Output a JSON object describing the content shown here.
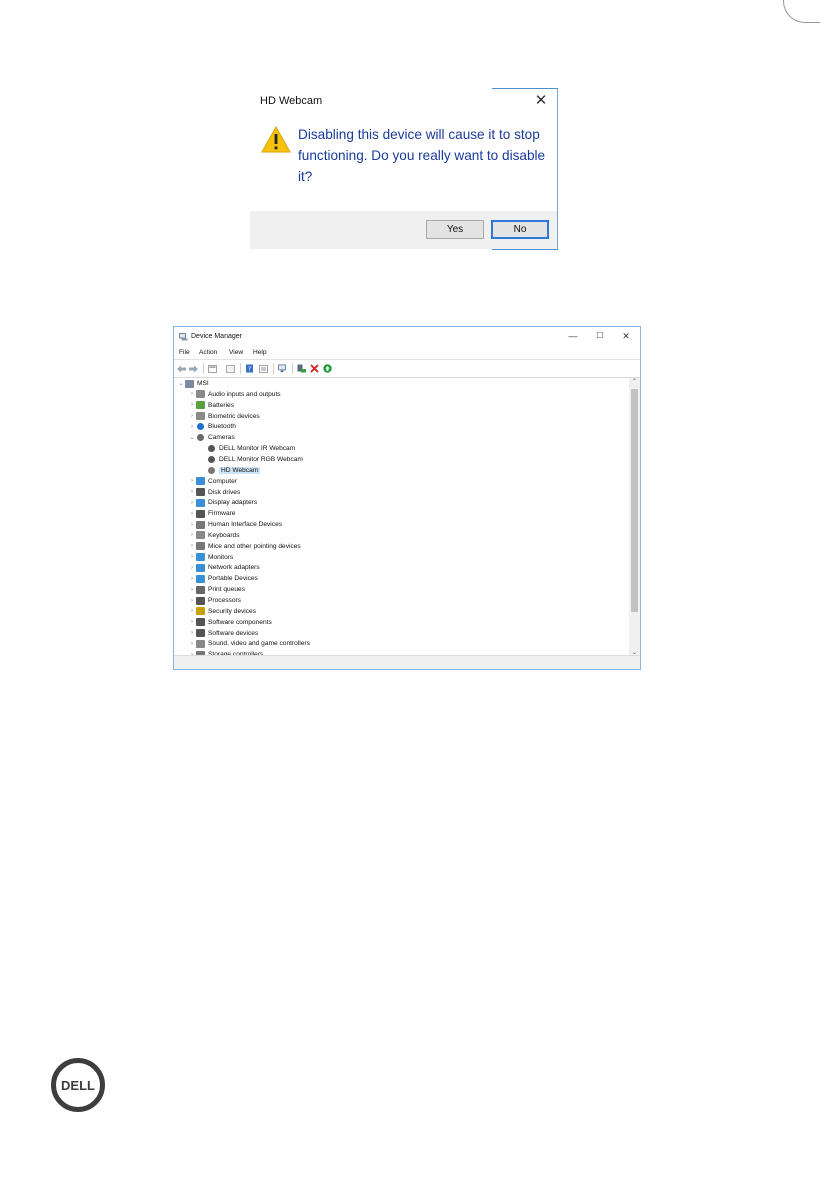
{
  "dialog": {
    "title": "HD Webcam",
    "close_glyph": "✕",
    "icon": "warning-icon",
    "message": "Disabling this device will cause it to stop functioning. Do you really want to disable it?",
    "buttons": {
      "yes": "Yes",
      "no": "No"
    },
    "colors": {
      "message": "#1a3a9a",
      "footer": "#f0f0f0",
      "focus": "#2d7ad6",
      "warning": "#f4c20d"
    }
  },
  "device_manager": {
    "title": "Device Manager",
    "window_buttons": {
      "minimize": "—",
      "maximize": "☐",
      "close": "✕"
    },
    "menu": [
      "File",
      "Action",
      "View",
      "Help"
    ],
    "toolbar_icons": [
      "back-icon",
      "forward-icon",
      "properties-icon",
      "show-hidden-icon",
      "help-icon",
      "driver-update-icon",
      "scan-icon",
      "enable-device-icon",
      "uninstall-device-icon",
      "update-icon"
    ],
    "tree": [
      {
        "label": "MSI",
        "level": 0,
        "expanded": true,
        "icon": "computer-icon",
        "color": "#7a8aa0"
      },
      {
        "label": "Audio inputs and outputs",
        "level": 1,
        "icon": "speaker-icon",
        "color": "#8a8a8a"
      },
      {
        "label": "Batteries",
        "level": 1,
        "icon": "battery-icon",
        "color": "#5aa040"
      },
      {
        "label": "Biometric devices",
        "level": 1,
        "icon": "biometric-icon",
        "color": "#8a8a8a"
      },
      {
        "label": "Bluetooth",
        "level": 1,
        "icon": "bluetooth-icon",
        "color": "#1f6fd0"
      },
      {
        "label": "Cameras",
        "level": 1,
        "expanded": true,
        "icon": "camera-icon",
        "color": "#6a6a6a"
      },
      {
        "label": "DELL Monitor IR Webcam",
        "level": 2,
        "icon": "webcam-icon",
        "color": "#555555"
      },
      {
        "label": "DELL Monitor RGB Webcam",
        "level": 2,
        "icon": "webcam-icon",
        "color": "#555555"
      },
      {
        "label": "HD Webcam",
        "level": 2,
        "selected": true,
        "icon": "webcam-disabled-icon",
        "color": "#777777"
      },
      {
        "label": "Computer",
        "level": 1,
        "icon": "monitor-icon",
        "color": "#3a8fd6"
      },
      {
        "label": "Disk drives",
        "level": 1,
        "icon": "disk-icon",
        "color": "#555555"
      },
      {
        "label": "Display adapters",
        "level": 1,
        "icon": "display-adapter-icon",
        "color": "#3a8fd6"
      },
      {
        "label": "Firmware",
        "level": 1,
        "icon": "firmware-icon",
        "color": "#555555"
      },
      {
        "label": "Human Interface Devices",
        "level": 1,
        "icon": "hid-icon",
        "color": "#777777"
      },
      {
        "label": "Keyboards",
        "level": 1,
        "icon": "keyboard-icon",
        "color": "#888888"
      },
      {
        "label": "Mice and other pointing devices",
        "level": 1,
        "icon": "mouse-icon",
        "color": "#777777"
      },
      {
        "label": "Monitors",
        "level": 1,
        "icon": "monitor-icon",
        "color": "#3a8fd6"
      },
      {
        "label": "Network adapters",
        "level": 1,
        "icon": "network-icon",
        "color": "#3a8fd6"
      },
      {
        "label": "Portable Devices",
        "level": 1,
        "icon": "portable-device-icon",
        "color": "#3a8fd6"
      },
      {
        "label": "Print queues",
        "level": 1,
        "icon": "printer-icon",
        "color": "#666666"
      },
      {
        "label": "Processors",
        "level": 1,
        "icon": "processor-icon",
        "color": "#555555"
      },
      {
        "label": "Security devices",
        "level": 1,
        "icon": "security-icon",
        "color": "#c8a000"
      },
      {
        "label": "Software components",
        "level": 1,
        "icon": "software-component-icon",
        "color": "#555555"
      },
      {
        "label": "Software devices",
        "level": 1,
        "icon": "software-device-icon",
        "color": "#555555"
      },
      {
        "label": "Sound, video and game controllers",
        "level": 1,
        "icon": "sound-icon",
        "color": "#888888"
      },
      {
        "label": "Storage controllers",
        "level": 1,
        "icon": "storage-icon",
        "color": "#777777"
      }
    ]
  },
  "footer_logo": {
    "text": "DELL",
    "icon": "dell-logo",
    "color": "#3d3d3d"
  }
}
